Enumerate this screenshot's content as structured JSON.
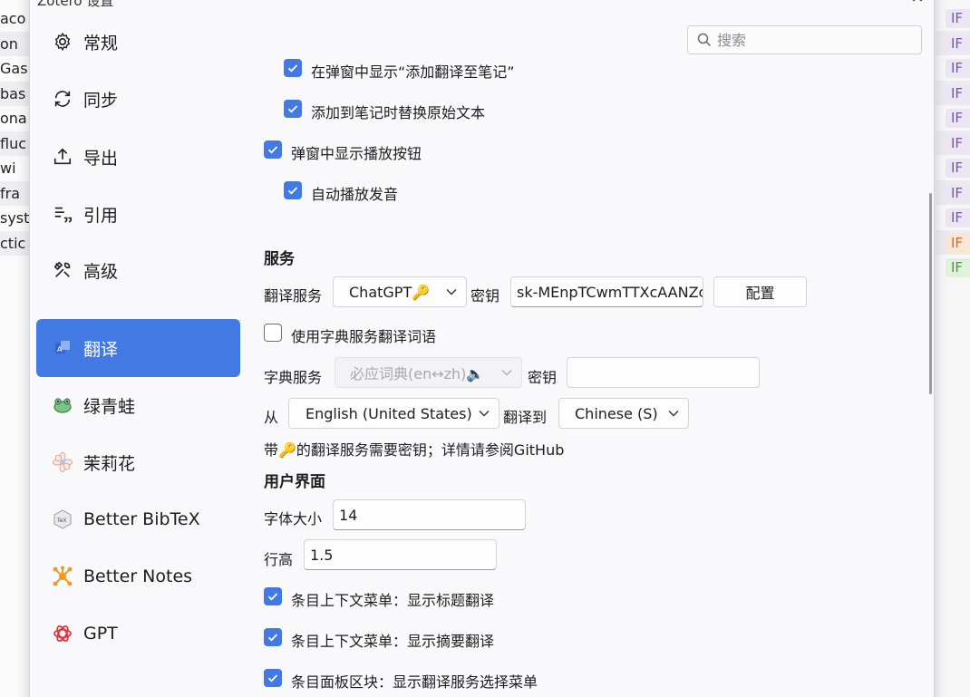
{
  "background": {
    "left_rows": [
      "aco",
      "on",
      "Gas",
      "bas",
      "ona",
      "fluc",
      "wi",
      "fra",
      "syst",
      "ctic"
    ],
    "right_tags": [
      {
        "label": "IF",
        "color": "purple"
      },
      {
        "label": "IF",
        "color": "purple"
      },
      {
        "label": "IF",
        "color": "purple"
      },
      {
        "label": "IF",
        "color": "purple"
      },
      {
        "label": "IF",
        "color": "purple"
      },
      {
        "label": "IF",
        "color": "purple"
      },
      {
        "label": "IF",
        "color": "purple"
      },
      {
        "label": "IF",
        "color": "purple"
      },
      {
        "label": "IF",
        "color": "purple"
      },
      {
        "label": "IF",
        "color": "orange"
      },
      {
        "label": "IF",
        "color": "green"
      }
    ]
  },
  "window": {
    "title": "Zotero 设置",
    "close_icon": "×"
  },
  "search": {
    "placeholder": "搜索"
  },
  "sidebar": {
    "items": [
      {
        "label": "常规",
        "icon": "gear-icon"
      },
      {
        "label": "同步",
        "icon": "sync-icon"
      },
      {
        "label": "导出",
        "icon": "export-icon"
      },
      {
        "label": "引用",
        "icon": "cite-icon"
      },
      {
        "label": "高级",
        "icon": "tools-icon"
      },
      {
        "label": "翻译",
        "icon": "translate-icon",
        "active": true
      },
      {
        "label": "绿青蛙",
        "icon": "frog-icon"
      },
      {
        "label": "茉莉花",
        "icon": "jasmine-icon"
      },
      {
        "label": "Better BibTeX",
        "icon": "bibtex-icon"
      },
      {
        "label": "Better Notes",
        "icon": "notes-icon"
      },
      {
        "label": "GPT",
        "icon": "gpt-icon"
      }
    ],
    "accent": "#4379e3"
  },
  "content": {
    "opt_popup_add_note": "在弹窗中显示“添加翻译至笔记”",
    "opt_replace_original": "添加到笔记时替换原始文本",
    "opt_show_play": "弹窗中显示播放按钮",
    "opt_autoplay": "自动播放发音",
    "section_service": "服务",
    "service_label": "翻译服务",
    "service_value": "ChatGPT🔑",
    "secret_label": "密钥",
    "secret_value": "sk-MEnpTCwmTTXcAANZc",
    "config_button": "配置",
    "opt_use_dict": "使用字典服务翻译词语",
    "dict_label": "字典服务",
    "dict_value": "必应词典(en↔zh)🔈",
    "dict_secret_label": "密钥",
    "dict_secret_value": "",
    "from_label": "从",
    "from_value": "English (United States)",
    "to_label": "翻译到",
    "to_value": "Chinese (S)",
    "key_note": "带🔑的翻译服务需要密钥；详情请参阅GitHub",
    "section_ui": "用户界面",
    "font_size_label": "字体大小",
    "font_size_value": "14",
    "line_height_label": "行高",
    "line_height_value": "1.5",
    "opt_menu_title": "条目上下文菜单：显示标题翻译",
    "opt_menu_abstract": "条目上下文菜单：显示摘要翻译",
    "opt_panel_menu": "条目面板区块：显示翻译服务选择菜单"
  }
}
